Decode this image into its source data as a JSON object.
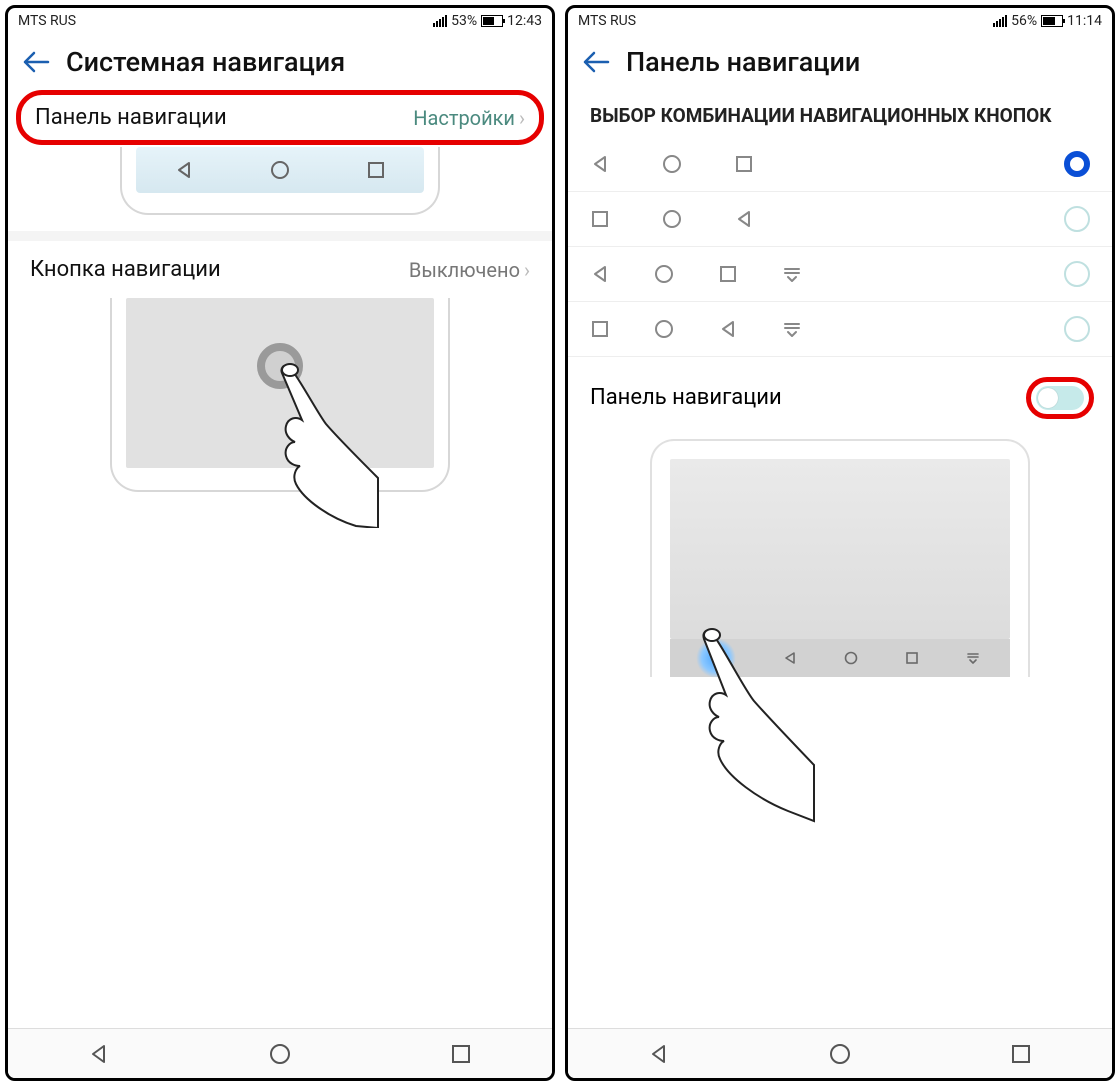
{
  "left": {
    "status": {
      "carrier": "MTS RUS",
      "battery_pct": "53%",
      "time": "12:43"
    },
    "title": "Системная навигация",
    "row1": {
      "label": "Панель навигации",
      "value": "Настройки"
    },
    "row2": {
      "label": "Кнопка навигации",
      "value": "Выключено"
    }
  },
  "right": {
    "status": {
      "carrier": "MTS RUS",
      "battery_pct": "56%",
      "time": "11:14"
    },
    "title": "Панель навигации",
    "section": "ВЫБОР КОМБИНАЦИИ НАВИГАЦИОННЫХ КНОПОК",
    "combos": [
      {
        "icons": [
          "back",
          "home",
          "square"
        ],
        "selected": true
      },
      {
        "icons": [
          "square",
          "home",
          "back"
        ],
        "selected": false
      },
      {
        "icons": [
          "back",
          "home",
          "square",
          "drop"
        ],
        "selected": false
      },
      {
        "icons": [
          "square",
          "home",
          "back",
          "drop"
        ],
        "selected": false
      }
    ],
    "toggle_label": "Панель навигации"
  }
}
